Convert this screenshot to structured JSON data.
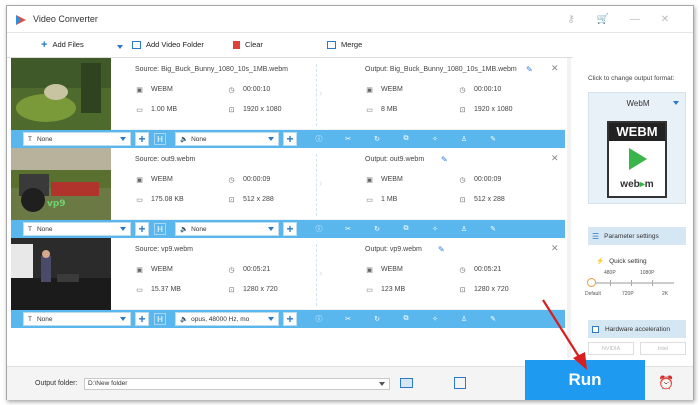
{
  "app": {
    "title": "Video Converter"
  },
  "toolbar": {
    "add_files": "Add Files",
    "add_video_folder": "Add Video Folder",
    "clear": "Clear",
    "merge": "Merge"
  },
  "items": [
    {
      "source": "Source: Big_Buck_Bunny_1080_10s_1MB.webm",
      "output": "Output: Big_Buck_Bunny_1080_10s_1MB.webm",
      "src_format": "WEBM",
      "src_duration": "00:00:10",
      "src_size": "1.00 MB",
      "src_res": "1920 x 1080",
      "out_format": "WEBM",
      "out_duration": "00:00:10",
      "out_size": "8 MB",
      "out_res": "1920 x 1080",
      "subtitle": "None",
      "audio": "None"
    },
    {
      "source": "Source: out9.webm",
      "output": "Output: out9.webm",
      "src_format": "WEBM",
      "src_duration": "00:00:09",
      "src_size": "175.08 KB",
      "src_res": "512 x 288",
      "out_format": "WEBM",
      "out_duration": "00:00:09",
      "out_size": "1 MB",
      "out_res": "512 x 288",
      "subtitle": "None",
      "audio": "None"
    },
    {
      "source": "Source: vp9.webm",
      "output": "Output: vp9.webm",
      "src_format": "WEBM",
      "src_duration": "00:05:21",
      "src_size": "15.37 MB",
      "src_res": "1280 x 720",
      "out_format": "WEBM",
      "out_duration": "00:05:21",
      "out_size": "123 MB",
      "out_res": "1280 x 720",
      "subtitle": "None",
      "audio": "opus, 48000 Hz, mo"
    }
  ],
  "right": {
    "click_format": "Click to change output format:",
    "format_name": "WebM",
    "webm_top": "WEBM",
    "webm_bottom": "web",
    "webm_bottom_tail": "m",
    "parameter_settings": "Parameter settings",
    "quick_setting": "Quick setting",
    "q_480p": "480P",
    "q_1080p": "1080P",
    "q_default": "Default",
    "q_720p": "720P",
    "q_2k": "2K",
    "hw_accel": "Hardware acceleration",
    "nvidia": "NVIDIA",
    "intel": "Intel"
  },
  "bottom": {
    "output_folder_label": "Output folder:",
    "output_folder_value": "D:\\New folder",
    "run": "Run"
  },
  "colors": {
    "accent": "#1e9bf0",
    "bar": "#5ab7ee",
    "arrow": "#d81e1e"
  }
}
